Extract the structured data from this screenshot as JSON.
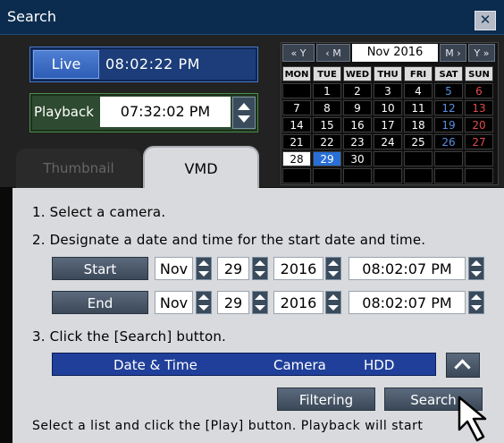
{
  "window": {
    "title": "Search",
    "close_glyph": "✕"
  },
  "live": {
    "button_label": "Live",
    "time": "08:02:22 PM"
  },
  "playback": {
    "label": "Playback",
    "time": "07:32:02 PM"
  },
  "calendar": {
    "nav": {
      "prev_year": "« Y",
      "prev_month": "‹ M",
      "month_label": "Nov 2016",
      "next_month": "M ›",
      "next_year": "Y »"
    },
    "weekdays": [
      "MON",
      "TUE",
      "WED",
      "THU",
      "FRI",
      "SAT",
      "SUN"
    ],
    "weeks": [
      [
        "",
        "1",
        "2",
        "3",
        "4",
        "5",
        "6"
      ],
      [
        "7",
        "8",
        "9",
        "10",
        "11",
        "12",
        "13"
      ],
      [
        "14",
        "15",
        "16",
        "17",
        "18",
        "19",
        "20"
      ],
      [
        "21",
        "22",
        "23",
        "24",
        "25",
        "26",
        "27"
      ],
      [
        "28",
        "29",
        "30",
        "",
        "",
        "",
        ""
      ],
      [
        "",
        "",
        "",
        "",
        "",
        "",
        ""
      ]
    ],
    "selected_day": "29"
  },
  "tabs": {
    "thumbnail": "Thumbnail",
    "vmd": "VMD"
  },
  "steps": {
    "step1": "1. Select a camera.",
    "step2": "2. Designate a date and time for the start date and time.",
    "step3": "3. Click the [Search] button."
  },
  "start": {
    "label": "Start",
    "month": "Nov",
    "day": "29",
    "year": "2016",
    "time": "08:02:07 PM"
  },
  "end": {
    "label": "End",
    "month": "Nov",
    "day": "29",
    "year": "2016",
    "time": "08:02:07 PM"
  },
  "list_header": {
    "date_time": "Date & Time",
    "camera": "Camera",
    "hdd": "HDD"
  },
  "actions": {
    "filtering": "Filtering",
    "search": "Search"
  },
  "footnote": "Select a list and click the [Play] button. Playback will start",
  "colors": {
    "title_bar": "#0b2c4e",
    "live_blue": "#2d5db5",
    "playback_green": "#4f8a4f",
    "list_header": "#1f3f9a",
    "saturday": "#5a8fe0",
    "sunday": "#e04b4b"
  }
}
